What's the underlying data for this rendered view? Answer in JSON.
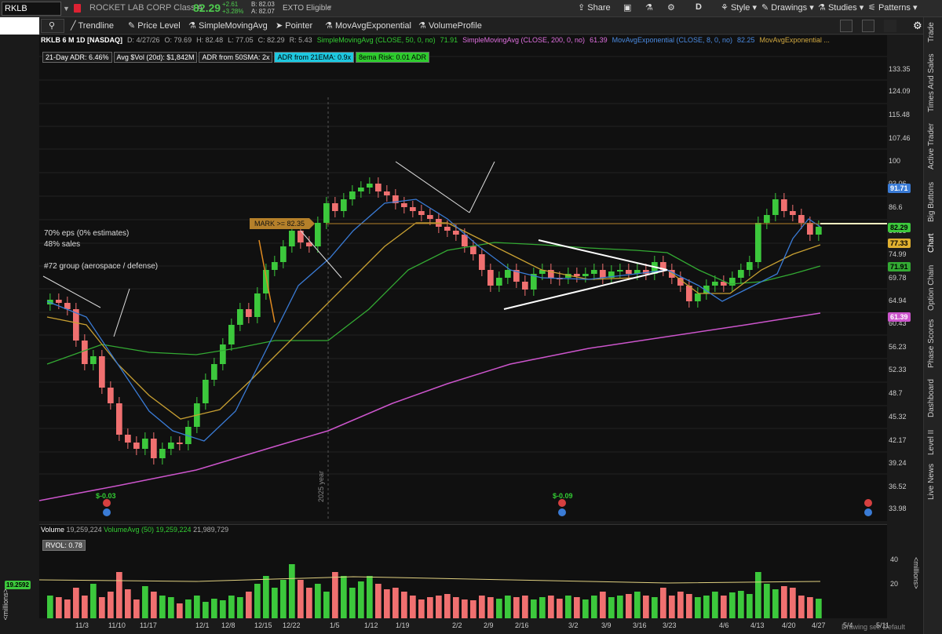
{
  "header": {
    "symbol": "RKLB",
    "company": "ROCKET LAB CORP Class A",
    "price": "82.29",
    "change": "+2.61",
    "change_pct": "+3.28%",
    "bid": "B: 82.03",
    "ask": "A: 82.07",
    "exto": "EXTO Eligible",
    "share": "Share",
    "period": "D",
    "style": "Style",
    "drawings": "Drawings",
    "studies": "Studies",
    "patterns": "Patterns"
  },
  "drawbar": {
    "trendline": "Trendline",
    "price_level": "Price Level",
    "sma": "SimpleMovingAvg",
    "pointer": "Pointer",
    "ema": "MovAvgExponential",
    "volume_profile": "VolumeProfile"
  },
  "info": {
    "title": "RKLB 6 M 1D [NASDAQ]",
    "date": "D: 4/27/26",
    "open": "O: 79.69",
    "high": "H: 82.48",
    "low": "L: 77.05",
    "close": "C: 82.29",
    "range": "R: 5.43",
    "sma50": "SimpleMovingAvg (CLOSE, 50, 0, no)",
    "sma50_val": "71.91",
    "sma200": "SimpleMovingAvg (CLOSE, 200, 0, no)",
    "sma200_val": "61.39",
    "ema8": "MovAvgExponential (CLOSE, 8, 0, no)",
    "ema8_val": "82.25",
    "ema21": "MovAvgExponential ..."
  },
  "stats": {
    "adr": "21-Day ADR: 6.46%",
    "avgvol": "Avg $Vol (20d): $1,842M",
    "adr50": "ADR from 50SMA: 2x",
    "adr21": "ADR from 21EMA: 0.9x",
    "risk": "8ema Risk: 0.01 ADR"
  },
  "annotations": {
    "eps": "70% eps (0% estimates)",
    "sales": "48% sales",
    "group": "#72 group (aerospace / defense)",
    "mark": "MARK >= 82.35",
    "year": "2025 year",
    "earn1": "$-0.03",
    "earn2": "$-0.09"
  },
  "yaxis": [
    "133.35",
    "124.09",
    "115.48",
    "107.46",
    "100",
    "93.06",
    "86.6",
    "80.58",
    "74.99",
    "69.78",
    "64.94",
    "60.43",
    "56.23",
    "52.33",
    "48.7",
    "45.32",
    "42.17",
    "39.24",
    "36.52",
    "33.98"
  ],
  "tags": {
    "ema8": "91.71",
    "price": "82.29",
    "ema21": "77.33",
    "sma50": "71.91",
    "sma200": "61.39"
  },
  "volume": {
    "label": "Volume",
    "v1": "19,259,224",
    "avg_label": "VolumeAvg (50)",
    "v2": "19,259,224",
    "v3": "21,989,729",
    "rvol": "RVOL: 0.78",
    "current": "19.2592",
    "axis_40": "40",
    "axis_20": "20",
    "units": "<millions>"
  },
  "xaxis": [
    "11/3",
    "11/10",
    "11/17",
    "12/1",
    "12/8",
    "12/15",
    "12/22",
    "1/5",
    "1/12",
    "1/19",
    "2/2",
    "2/9",
    "2/16",
    "3/2",
    "3/9",
    "3/16",
    "3/23",
    "4/6",
    "4/13",
    "4/20",
    "4/27",
    "5/4",
    "5/11"
  ],
  "right_tabs": [
    "Trade",
    "Times And Sales",
    "Active Trader",
    "Big Buttons",
    "Chart",
    "Option Chain",
    "Phase Scores",
    "Dashboard",
    "Level II",
    "Live News"
  ],
  "status": "Drawing set: Default",
  "colors": {
    "up": "#3cc83c",
    "down": "#f07070",
    "ema8": "#3a7bd5",
    "ema21": "#c8a032",
    "sma50": "#33aa33",
    "sma200": "#cc55cc"
  }
}
